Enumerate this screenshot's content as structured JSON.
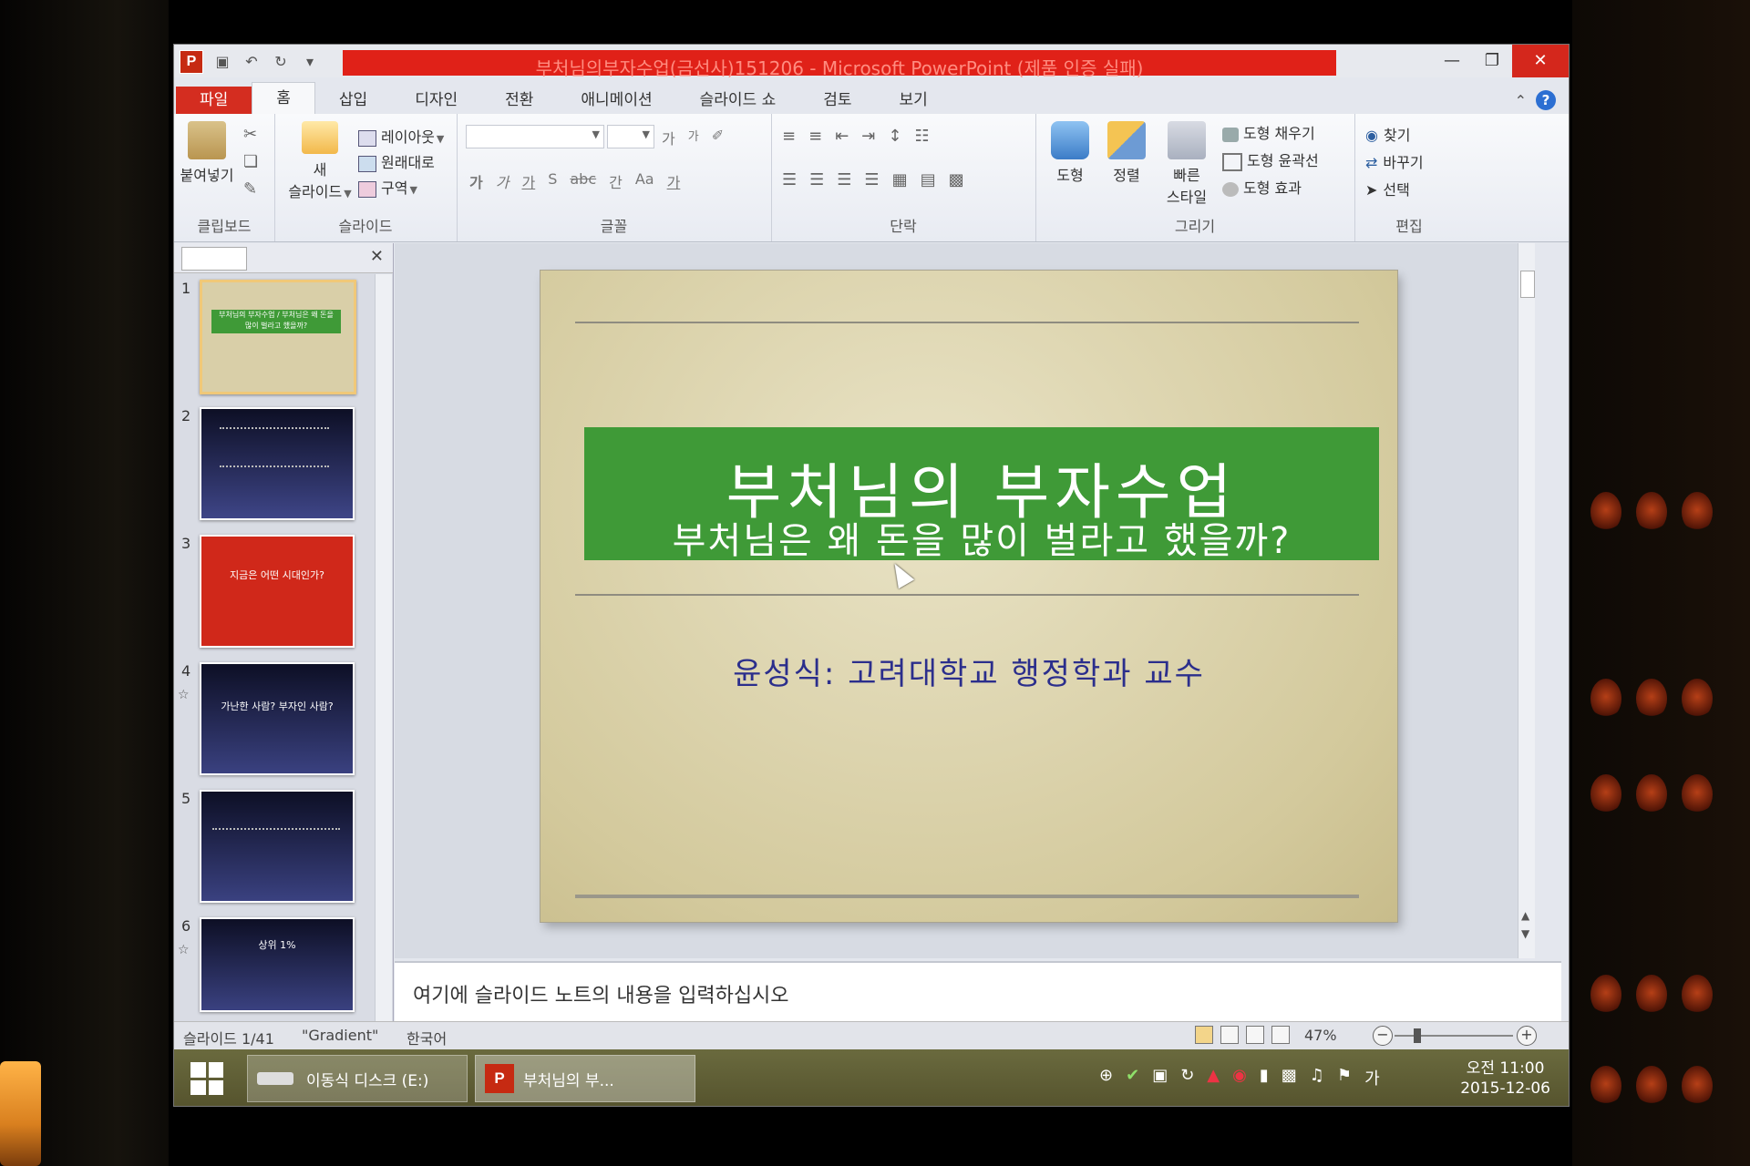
{
  "window": {
    "title": "부처님의부자수업(금선사)151206 - Microsoft PowerPoint (제품 인증 실패)",
    "app_icon": "P"
  },
  "ribbon_tabs": [
    "파일",
    "홈",
    "삽입",
    "디자인",
    "전환",
    "애니메이션",
    "슬라이드 쇼",
    "검토",
    "보기"
  ],
  "ribbon": {
    "clipboard": {
      "paste": "붙여넣기",
      "label": "클립보드"
    },
    "slides": {
      "new_slide_1": "새",
      "new_slide_2": "슬라이드",
      "layout": "레이아웃",
      "reset": "원래대로",
      "section": "구역",
      "label": "슬라이드"
    },
    "font": {
      "label": "글꼴",
      "grow": "가",
      "shrink": "가",
      "bold": "가",
      "italic": "가",
      "underline": "가",
      "shadow": "S",
      "strike": "abc",
      "spacing": "간",
      "case": "Aa",
      "color": "가"
    },
    "paragraph": {
      "label": "단락"
    },
    "drawing": {
      "shapes": "도형",
      "arrange": "정렬",
      "quick_styles_1": "빠른",
      "quick_styles_2": "스타일",
      "fill": "도형 채우기",
      "outline": "도형 윤곽선",
      "effects": "도형 효과",
      "label": "그리기"
    },
    "editing": {
      "find": "찾기",
      "replace": "바꾸기",
      "select": "선택",
      "label": "편집"
    }
  },
  "thumbnails": [
    {
      "num": "1",
      "text": "부처님의 부자수업 / 부처님은 왜 돈을 많이 벌라고 했을까?",
      "bg": "#d9cfa8"
    },
    {
      "num": "2",
      "text": "",
      "bg": "#2c2f6a"
    },
    {
      "num": "3",
      "text": "지금은 어떤 시대인가?",
      "bg": "#d0281a"
    },
    {
      "num": "4",
      "text": "가난한 사람? 부자인 사람?",
      "bg": "#22275e"
    },
    {
      "num": "5",
      "text": "",
      "bg": "#1e2250"
    },
    {
      "num": "6",
      "text": "상위 1%",
      "bg": "#1e2250"
    }
  ],
  "slide": {
    "title": "부처님의 부자수업",
    "subtitle": "부처님은 왜 돈을 많이 벌라고 했을까?",
    "author": "윤성식: 고려대학교 행정학과 교수"
  },
  "notes": {
    "placeholder": "여기에 슬라이드 노트의 내용을 입력하십시오"
  },
  "status": {
    "slide_count": "슬라이드 1/41",
    "theme": "\"Gradient\"",
    "language": "한국어",
    "zoom": "47%"
  },
  "taskbar": {
    "drive_label": "이동식 디스크 (E:)",
    "ppt_label": "부처님의 부...",
    "ime": "가",
    "time": "오전 11:00",
    "date": "2015-12-06"
  }
}
